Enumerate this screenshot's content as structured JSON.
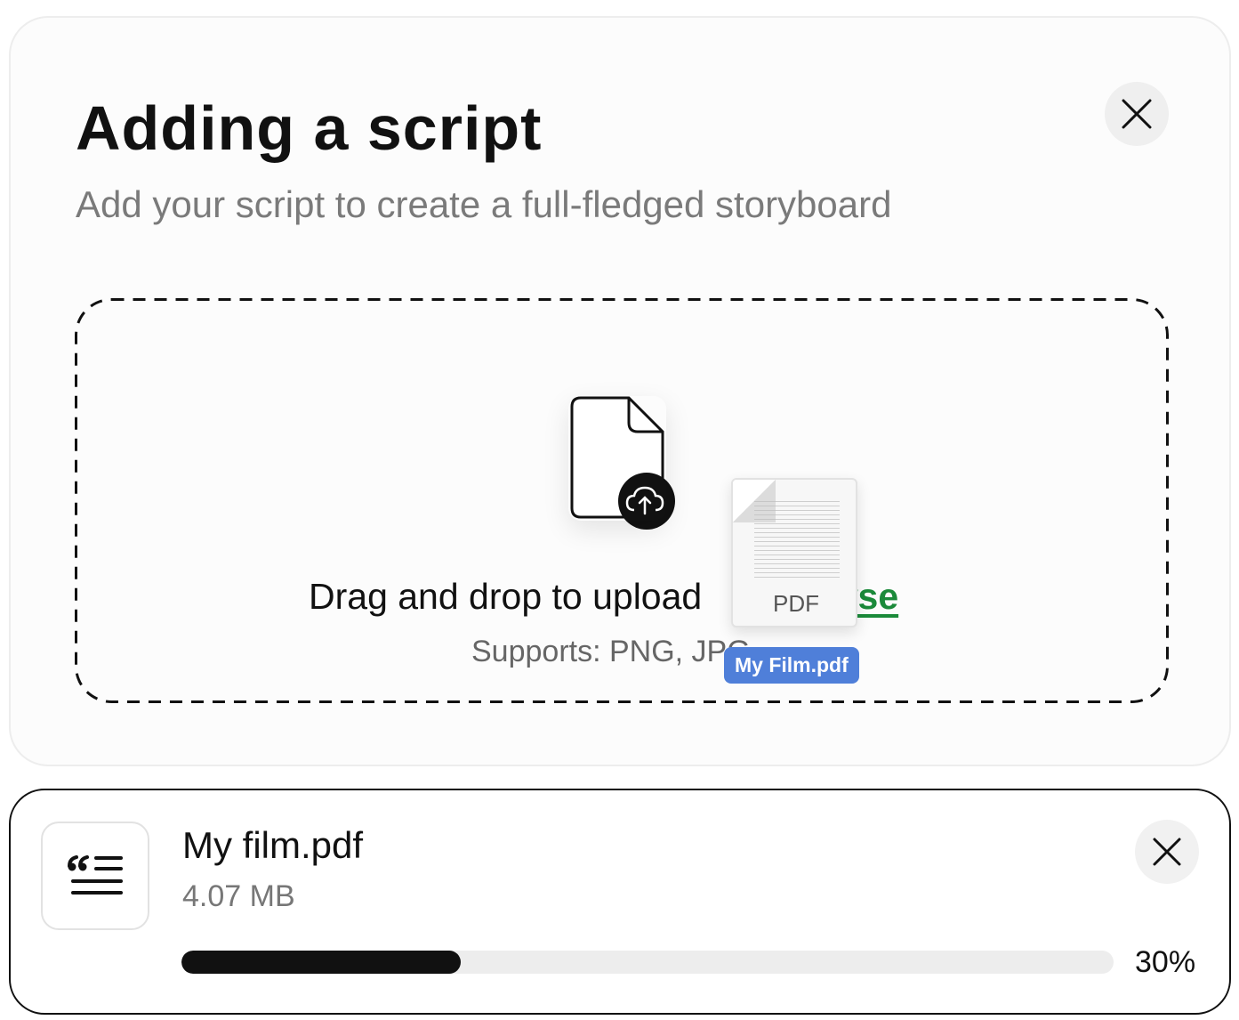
{
  "modal": {
    "title": "Adding a script",
    "subtitle": "Add your script to create a full-fledged storyboard",
    "close_icon": "close-icon"
  },
  "dropzone": {
    "icon": "file-upload-icon",
    "drag_text": "Drag and drop to upload",
    "browse_visible_fragment": "wse",
    "supports_text": "Supports: PNG, JPG",
    "link_color": "#1b8a3a"
  },
  "drag_ghost": {
    "type_label": "PDF",
    "file_name": "My Film.pdf",
    "badge_color": "#4f7fd9"
  },
  "upload_item": {
    "icon": "script-quote-icon",
    "file_name": "My film.pdf",
    "file_size": "4.07 MB",
    "progress": 0.3,
    "progress_label": "30%",
    "close_icon": "close-icon"
  }
}
